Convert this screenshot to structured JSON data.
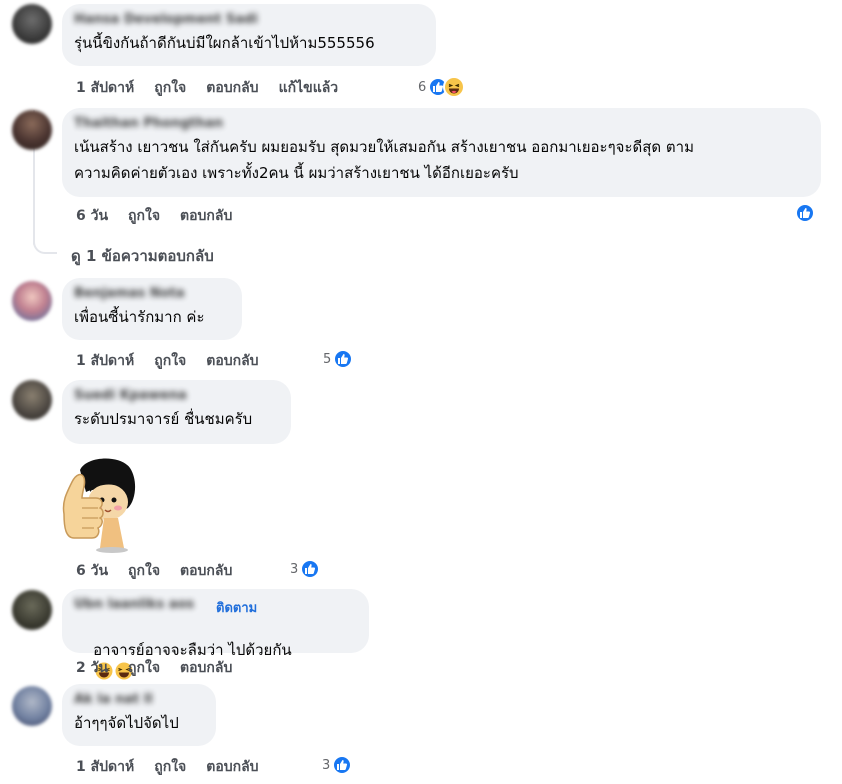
{
  "comments": [
    {
      "author": "Hansa Development Sadi",
      "text": "รุ่นนี้ขิงกันถ้าดีกันบ่มีใผกล้าเข้าไปห้าม555556",
      "time": "1 สัปดาห์",
      "like": "ถูกใจ",
      "reply": "ตอบกลับ",
      "edited": "แก้ไขแล้ว",
      "reaction_count": "6",
      "reactions": [
        "like-icon",
        "haha-icon"
      ]
    },
    {
      "author": "Thaithan Phongthan",
      "text": "เน้นสร้าง เยาวชน ใส่กันครับ ผมยอมรับ สุดมวยให้เสมอกัน สร้างเยาชน ออกมาเยอะๆจะดีสุด ตาม\nความคิดค่ายตัวเอง เพราะทั้ง2คน นี้ ผมว่าสร้างเยาชน ได้อีกเยอะครับ",
      "time": "6 วัน",
      "like": "ถูกใจ",
      "reply": "ตอบกลับ",
      "reactions": [
        "like-icon"
      ],
      "view_replies": "ดู 1 ข้อความตอบกลับ"
    },
    {
      "author": "Benjamas Nota",
      "text": "เพื่อนซี้น่ารักมาก ค่ะ",
      "time": "1 สัปดาห์",
      "like": "ถูกใจ",
      "reply": "ตอบกลับ",
      "reaction_count": "5",
      "reactions": [
        "like-icon"
      ]
    },
    {
      "author": "Suedi Kpawena",
      "text": "ระดับปรมาจารย์ ชื่นชมครับ",
      "time": "6 วัน",
      "like": "ถูกใจ",
      "reply": "ตอบกลับ",
      "reaction_count": "3",
      "reactions": [
        "like-icon"
      ],
      "sticker": "thumbs-up-girl-sticker"
    },
    {
      "author": "Ubn laanliks aos",
      "follow": "ติดตาม",
      "text": "อาจารย์อาจจะลืมว่า ไปด้วยกัน",
      "text_emoji": [
        "laughing-emoji",
        "laughing-emoji"
      ],
      "time": "2 วัน",
      "like": "ถูกใจ",
      "reply": "ตอบกลับ"
    },
    {
      "author": "Ak la nat ll",
      "text": "อ้าๆๆจัดไปจัดไป",
      "time": "1 สัปดาห์",
      "like": "ถูกใจ",
      "reply": "ตอบกลับ",
      "reaction_count": "3",
      "reactions": [
        "like-icon"
      ]
    }
  ],
  "colors": {
    "bubble": "#f0f2f5",
    "like_blue": "#1877f2",
    "follow_blue": "#216fdb",
    "action_gray": "#4b4f56"
  }
}
